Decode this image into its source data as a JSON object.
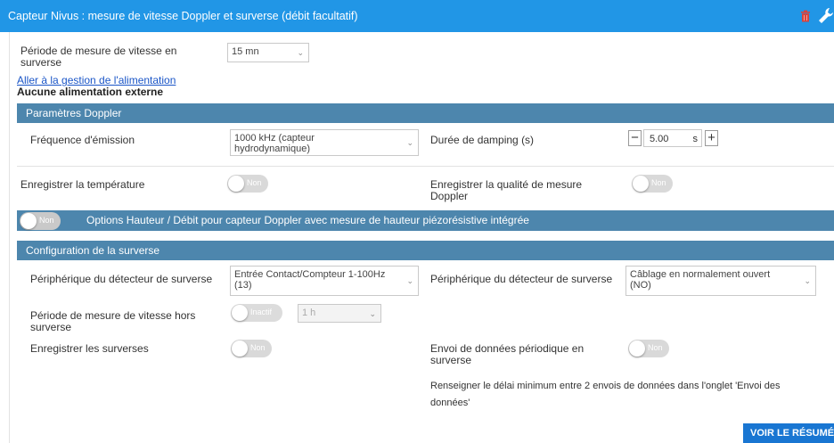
{
  "header": {
    "title": "Capteur Nivus : mesure de vitesse Doppler et surverse (débit facultatif)"
  },
  "period_speed": {
    "label": "Période de mesure de vitesse en\nsurverse",
    "value": "15 mn"
  },
  "power_link": "Aller à la gestion de l'alimentation",
  "power_status": "Aucune alimentation externe",
  "doppler": {
    "title": "Paramètres Doppler",
    "freq_label": "Fréquence d'émission",
    "freq_value": "1000 kHz (capteur\nhydrodynamique)",
    "damping_label": "Durée de damping (s)",
    "damping_value": "5.00",
    "damping_unit": "s",
    "minus": "−",
    "plus": "+"
  },
  "temperature": {
    "label": "Enregistrer la température",
    "toggle": "Non"
  },
  "quality": {
    "label": "Enregistrer la qualité de mesure\nDoppler",
    "toggle": "Non"
  },
  "options_bar": {
    "toggle": "Non",
    "label": "Options Hauteur / Débit pour capteur Doppler avec mesure de hauteur piézorésistive intégrée"
  },
  "overflow": {
    "title": "Configuration de la surverse",
    "device1_label": "Périphérique du détecteur de surverse",
    "device1_value": "Entrée Contact/Compteur 1-100Hz\n(13)",
    "device2_label": "Périphérique du détecteur de surverse",
    "device2_value": "Câblage en normalement ouvert\n(NO)",
    "period_label": "Période de mesure de vitesse hors\nsurverse",
    "period_toggle": "Inactif",
    "period_value": "1 h",
    "record_label": "Enregistrer les surverses",
    "record_toggle": "Non",
    "periodic_label": "Envoi de données périodique en\nsurverse",
    "periodic_toggle": "Non",
    "note": "Renseigner le délai minimum entre 2 envois de données dans l'onglet 'Envoi des\ndonnées'"
  },
  "footer": {
    "resume_button": "VOIR LE RÉSUMÉ"
  },
  "colors": {
    "header": "#2196e6",
    "section": "#4d86ad",
    "button": "#1976d2",
    "link": "#1a55c7"
  }
}
